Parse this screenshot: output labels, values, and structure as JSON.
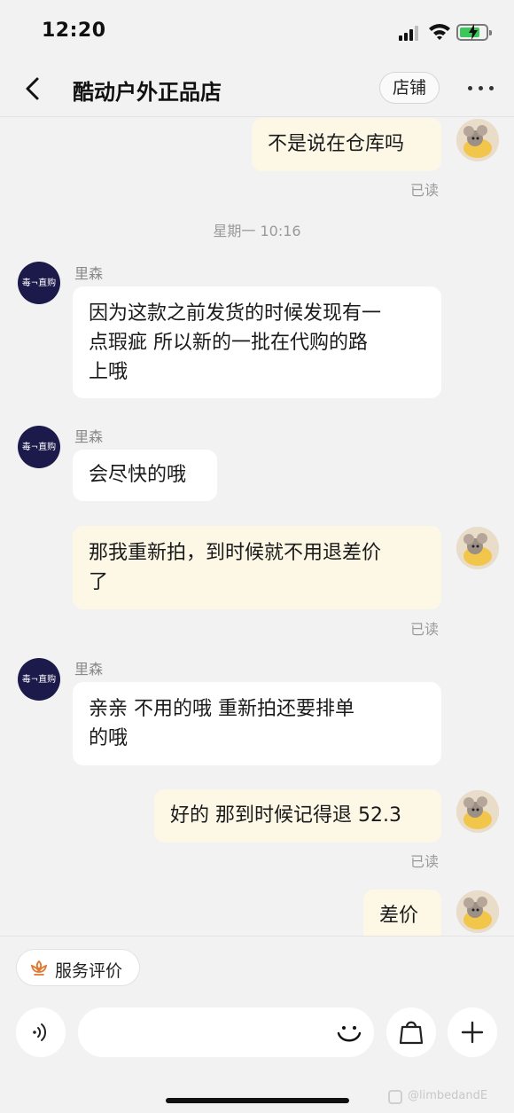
{
  "status_bar": {
    "time": "12:20"
  },
  "header": {
    "title": "酷动户外正品店",
    "shop_label": "店铺"
  },
  "shop_avatar_text": "毒¬直购",
  "messages": {
    "m1": {
      "lines": [
        "不是说在仓库吗"
      ],
      "read": "已读"
    },
    "timestamp": "星期一 10:16",
    "m2": {
      "sender": "里森",
      "lines": [
        "因为这款之前发货的时候发现有一",
        "点瑕疵  所以新的一批在代购的路",
        "上哦"
      ]
    },
    "m3": {
      "sender": "里森",
      "lines": [
        "会尽快的哦"
      ]
    },
    "m4": {
      "lines": [
        "那我重新拍，到时候就不用退差价",
        "了"
      ],
      "read": "已读"
    },
    "m5": {
      "sender": "里森",
      "lines": [
        "亲亲  不用的哦    重新拍还要排单",
        "的哦"
      ]
    },
    "m6": {
      "lines": [
        "好的 那到时候记得退 52.3"
      ],
      "read": "已读"
    },
    "m7": {
      "lines": [
        "差价"
      ]
    }
  },
  "bottom": {
    "service_label": "服务评价",
    "input_placeholder": "",
    "watermark": "@limbedandE"
  },
  "colors": {
    "bubble_out": "#fdf8e6",
    "bubble_in": "#ffffff",
    "background": "#f2f2f2",
    "battery": "#3cc75a",
    "service_icon": "#e0782f",
    "shop_avatar": "#1b1a4a"
  }
}
